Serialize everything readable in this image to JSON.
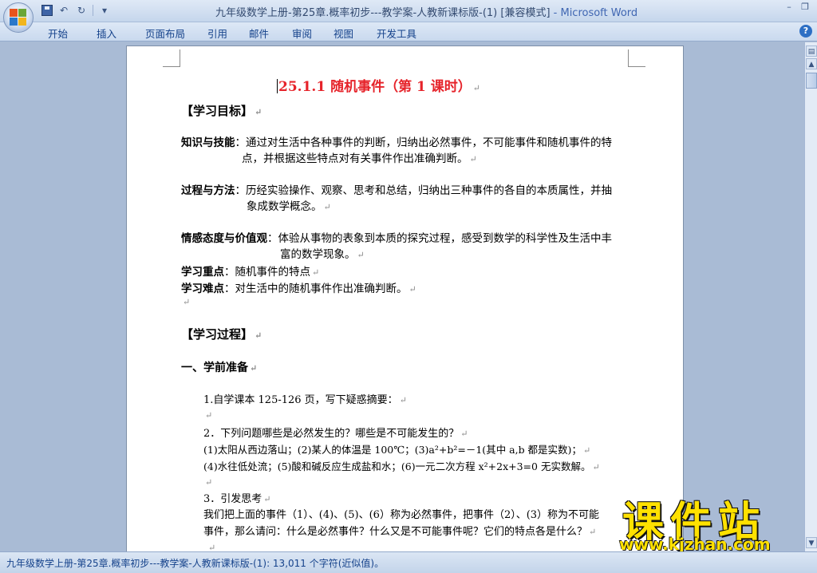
{
  "window": {
    "title": "九年级数学上册-第25章.概率初步---教学案-人教新课标版-(1) [兼容模式]",
    "app_name": " - Microsoft Word"
  },
  "ribbon": {
    "tabs": [
      "开始",
      "插入",
      "页面布局",
      "引用",
      "邮件",
      "审阅",
      "视图",
      "开发工具"
    ]
  },
  "document": {
    "title": "25.1.1 随机事件（第 1 课时）",
    "objectives_heading": "【学习目标】",
    "knowledge_label": "知识与技能",
    "knowledge_text_1": "：通过对生活中各种事件的判断，归纳出必然事件，不可能事件和随机事件的特",
    "knowledge_text_2": "点，并根据这些特点对有关事件作出准确判断。",
    "process_label": "过程与方法",
    "process_text_1": "：历经实验操作、观察、思考和总结，归纳出三种事件的各自的本质属性，并抽",
    "process_text_2": "象成数学概念。",
    "emotion_label": "情感态度与价值观",
    "emotion_text_1": "：体验从事物的表象到本质的探究过程，感受到数学的科学性及生活中丰",
    "emotion_text_2": "富的数学现象。",
    "key_label": "学习重点",
    "key_text": "：随机事件的特点",
    "difficulty_label": "学习难点",
    "difficulty_text": "：对生活中的随机事件作出准确判断。",
    "process_heading": "【学习过程】",
    "section1_heading": "一、学前准备",
    "item1": "1.自学课本 125-126 页，写下疑惑摘要：",
    "item2": "2．下列问题哪些是必然发生的？哪些是不可能发生的？",
    "item2_a": "(1)太阳从西边落山；(2)某人的体温是 100℃；(3)a²+b²=－1(其中 a,b 都是实数)；",
    "item2_b": "(4)水往低处流；(5)酸和碱反应生成盐和水；(6)一元二次方程 x²+2x+3=0 无实数解。",
    "item3": "3．引发思考",
    "item3_a": "我们把上面的事件（1）、(4)、(5)、(6）称为必然事件，把事件（2）、(3）称为不可能",
    "item3_b": "事件，那么请问：什么是必然事件？什么又是不可能事件呢？它们的特点各是什么？"
  },
  "status": {
    "text": "九年级数学上册-第25章.概率初步---教学案-人教新课标版-(1): 13,011 个字符(近似值)。"
  },
  "watermark": {
    "main": "课件站",
    "url": "www.kjzhan.com"
  },
  "icons": {
    "paragraph_mark": "↵",
    "undo": "↶",
    "redo": "↻",
    "qat_more": "▾",
    "minimize": "–",
    "restore": "❐",
    "help": "?"
  }
}
